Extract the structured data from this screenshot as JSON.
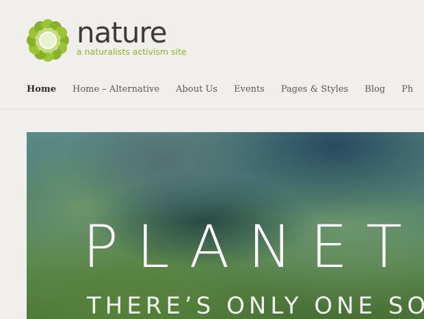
{
  "site": {
    "title": "nature",
    "tagline": "a naturalists activism site",
    "logo_icon": "flower-logo-icon",
    "colors": {
      "brand_green": "#8bb529",
      "title_dark": "#3d3a37",
      "background": "#f1efec"
    }
  },
  "nav": {
    "items": [
      {
        "label": "Home",
        "active": true
      },
      {
        "label": "Home – Alternative",
        "active": false
      },
      {
        "label": "About Us",
        "active": false
      },
      {
        "label": "Events",
        "active": false
      },
      {
        "label": "Pages & Styles",
        "active": false
      },
      {
        "label": "Blog",
        "active": false
      },
      {
        "label": "Ph",
        "active": false
      }
    ]
  },
  "hero": {
    "title": "PLANETE",
    "subtitle": "THERE’S ONLY ONE SO"
  }
}
